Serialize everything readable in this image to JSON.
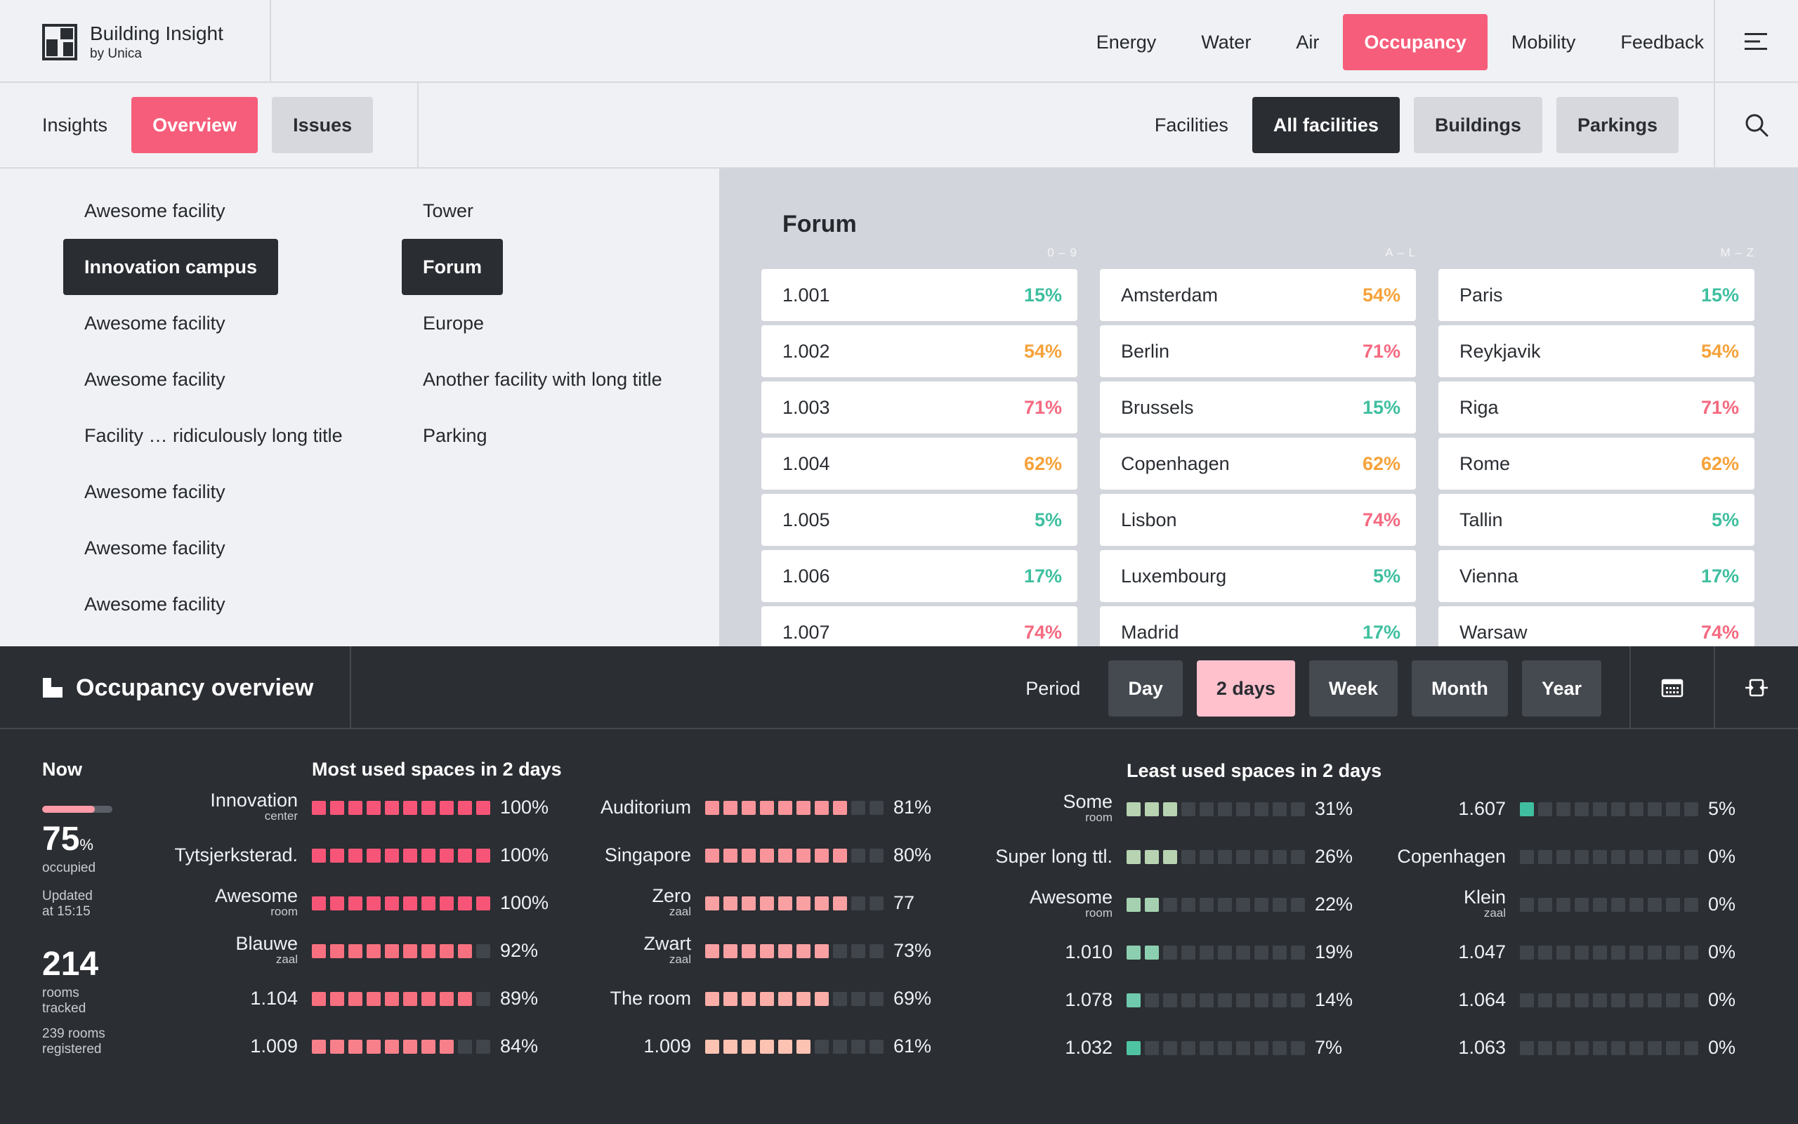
{
  "brand": {
    "name": "Building Insight",
    "sub": "by Unica"
  },
  "nav": [
    {
      "label": "Energy",
      "active": false
    },
    {
      "label": "Water",
      "active": false
    },
    {
      "label": "Air",
      "active": false
    },
    {
      "label": "Occupancy",
      "active": true
    },
    {
      "label": "Mobility",
      "active": false
    },
    {
      "label": "Feedback",
      "active": false
    }
  ],
  "subnav": {
    "insights_label": "Insights",
    "overview_label": "Overview",
    "issues_label": "Issues",
    "facilities_label": "Facilities",
    "all_facilities_label": "All facilities",
    "buildings_label": "Buildings",
    "parkings_label": "Parkings"
  },
  "facilities": {
    "col1": [
      {
        "label": "Awesome facility",
        "selected": false
      },
      {
        "label": "Innovation campus",
        "selected": true
      },
      {
        "label": "Awesome facility",
        "selected": false
      },
      {
        "label": "Awesome facility",
        "selected": false
      },
      {
        "label": "Facility … ridiculously long title",
        "selected": false
      },
      {
        "label": "Awesome facility",
        "selected": false
      },
      {
        "label": "Awesome facility",
        "selected": false
      },
      {
        "label": "Awesome facility",
        "selected": false
      }
    ],
    "col2": [
      {
        "label": "Tower",
        "selected": false
      },
      {
        "label": "Forum",
        "selected": true
      },
      {
        "label": "Europe",
        "selected": false
      },
      {
        "label": "Another facility with long title",
        "selected": false
      },
      {
        "label": "Parking",
        "selected": false
      }
    ]
  },
  "forum": {
    "title": "Forum",
    "ranges": [
      "0 – 9",
      "A – L",
      "M – Z"
    ],
    "columns": [
      [
        {
          "name": "1.001",
          "pct": "15%",
          "level": "low"
        },
        {
          "name": "1.002",
          "pct": "54%",
          "level": "mid"
        },
        {
          "name": "1.003",
          "pct": "71%",
          "level": "high"
        },
        {
          "name": "1.004",
          "pct": "62%",
          "level": "mid"
        },
        {
          "name": "1.005",
          "pct": "5%",
          "level": "low"
        },
        {
          "name": "1.006",
          "pct": "17%",
          "level": "low"
        },
        {
          "name": "1.007",
          "pct": "74%",
          "level": "high"
        }
      ],
      [
        {
          "name": "Amsterdam",
          "pct": "54%",
          "level": "mid"
        },
        {
          "name": "Berlin",
          "pct": "71%",
          "level": "high"
        },
        {
          "name": "Brussels",
          "pct": "15%",
          "level": "low"
        },
        {
          "name": "Copenhagen",
          "pct": "62%",
          "level": "mid"
        },
        {
          "name": "Lisbon",
          "pct": "74%",
          "level": "high"
        },
        {
          "name": "Luxembourg",
          "pct": "5%",
          "level": "low"
        },
        {
          "name": "Madrid",
          "pct": "17%",
          "level": "low"
        }
      ],
      [
        {
          "name": "Paris",
          "pct": "15%",
          "level": "low"
        },
        {
          "name": "Reykjavik",
          "pct": "54%",
          "level": "mid"
        },
        {
          "name": "Riga",
          "pct": "71%",
          "level": "high"
        },
        {
          "name": "Rome",
          "pct": "62%",
          "level": "mid"
        },
        {
          "name": "Tallin",
          "pct": "5%",
          "level": "low"
        },
        {
          "name": "Vienna",
          "pct": "17%",
          "level": "low"
        },
        {
          "name": "Warsaw",
          "pct": "74%",
          "level": "high"
        }
      ]
    ]
  },
  "level_colors": {
    "low": "#3fbfa0",
    "mid": "#f6a23a",
    "high": "#f46a80"
  },
  "occupancy": {
    "title": "Occupancy overview",
    "period_label": "Period",
    "periods": [
      {
        "label": "Day",
        "active": false
      },
      {
        "label": "2 days",
        "active": true
      },
      {
        "label": "Week",
        "active": false
      },
      {
        "label": "Month",
        "active": false
      },
      {
        "label": "Year",
        "active": false
      }
    ],
    "now": {
      "label": "Now",
      "occupied_pct": 75,
      "pct_unit": "%",
      "occupied_label": "occupied",
      "updated_line1": "Updated",
      "updated_line2": "at 15:15",
      "rooms_tracked": "214",
      "rooms_label1": "rooms",
      "rooms_label2": "tracked",
      "registered_line1": "239 rooms",
      "registered_line2": "registered"
    },
    "most_used_title": "Most used spaces in 2 days",
    "least_used_title": "Least used spaces in 2 days",
    "most_used": [
      [
        {
          "name": "Innovation",
          "sub": "center",
          "value": "100%",
          "fill": 10,
          "color": "#f75577"
        },
        {
          "name": "Tytsjerksterad.",
          "sub": "",
          "value": "100%",
          "fill": 10,
          "color": "#f75577"
        },
        {
          "name": "Awesome",
          "sub": "room",
          "value": "100%",
          "fill": 10,
          "color": "#f75577"
        },
        {
          "name": "Blauwe",
          "sub": "zaal",
          "value": "92%",
          "fill": 9,
          "color": "#f7707f"
        },
        {
          "name": "1.104",
          "sub": "",
          "value": "89%",
          "fill": 9,
          "color": "#f7707f"
        },
        {
          "name": "1.009",
          "sub": "",
          "value": "84%",
          "fill": 8,
          "color": "#f7808a"
        }
      ],
      [
        {
          "name": "Auditorium",
          "sub": "",
          "value": "81%",
          "fill": 8,
          "color": "#f9959a"
        },
        {
          "name": "Singapore",
          "sub": "",
          "value": "80%",
          "fill": 8,
          "color": "#f9959a"
        },
        {
          "name": "Zero",
          "sub": "zaal",
          "value": "77",
          "fill": 8,
          "color": "#f9a0a2"
        },
        {
          "name": "Zwart",
          "sub": "zaal",
          "value": "73%",
          "fill": 7,
          "color": "#f9a0a2"
        },
        {
          "name": "The room",
          "sub": "",
          "value": "69%",
          "fill": 7,
          "color": "#fbaea8"
        },
        {
          "name": "1.009",
          "sub": "",
          "value": "61%",
          "fill": 6,
          "color": "#fcc2b2"
        }
      ]
    ],
    "least_used": [
      [
        {
          "name": "Some",
          "sub": "room",
          "value": "31%",
          "fill": 3,
          "color": "#b7d3b1"
        },
        {
          "name": "Super long ttl.",
          "sub": "",
          "value": "26%",
          "fill": 3,
          "color": "#b7d3b1"
        },
        {
          "name": "Awesome",
          "sub": "room",
          "value": "22%",
          "fill": 2,
          "color": "#a5d1b0"
        },
        {
          "name": "1.010",
          "sub": "",
          "value": "19%",
          "fill": 2,
          "color": "#8ccfb0"
        },
        {
          "name": "1.078",
          "sub": "",
          "value": "14%",
          "fill": 1,
          "color": "#6fc9ac"
        },
        {
          "name": "1.032",
          "sub": "",
          "value": "7%",
          "fill": 1,
          "color": "#4fc4a2"
        }
      ],
      [
        {
          "name": "1.607",
          "sub": "",
          "value": "5%",
          "fill": 1,
          "color": "#3fbfa0"
        },
        {
          "name": "Copenhagen",
          "sub": "",
          "value": "0%",
          "fill": 0,
          "color": "#3fbfa0"
        },
        {
          "name": "Klein",
          "sub": "zaal",
          "value": "0%",
          "fill": 0,
          "color": "#3fbfa0"
        },
        {
          "name": "1.047",
          "sub": "",
          "value": "0%",
          "fill": 0,
          "color": "#3fbfa0"
        },
        {
          "name": "1.064",
          "sub": "",
          "value": "0%",
          "fill": 0,
          "color": "#3fbfa0"
        },
        {
          "name": "1.063",
          "sub": "",
          "value": "0%",
          "fill": 0,
          "color": "#3fbfa0"
        }
      ]
    ]
  },
  "icons": {
    "logo": "building-logo-icon",
    "menu": "menu-icon",
    "search": "search-icon",
    "occupancy": "occupancy-icon",
    "calendar": "calendar-icon",
    "expand": "expand-icon"
  }
}
